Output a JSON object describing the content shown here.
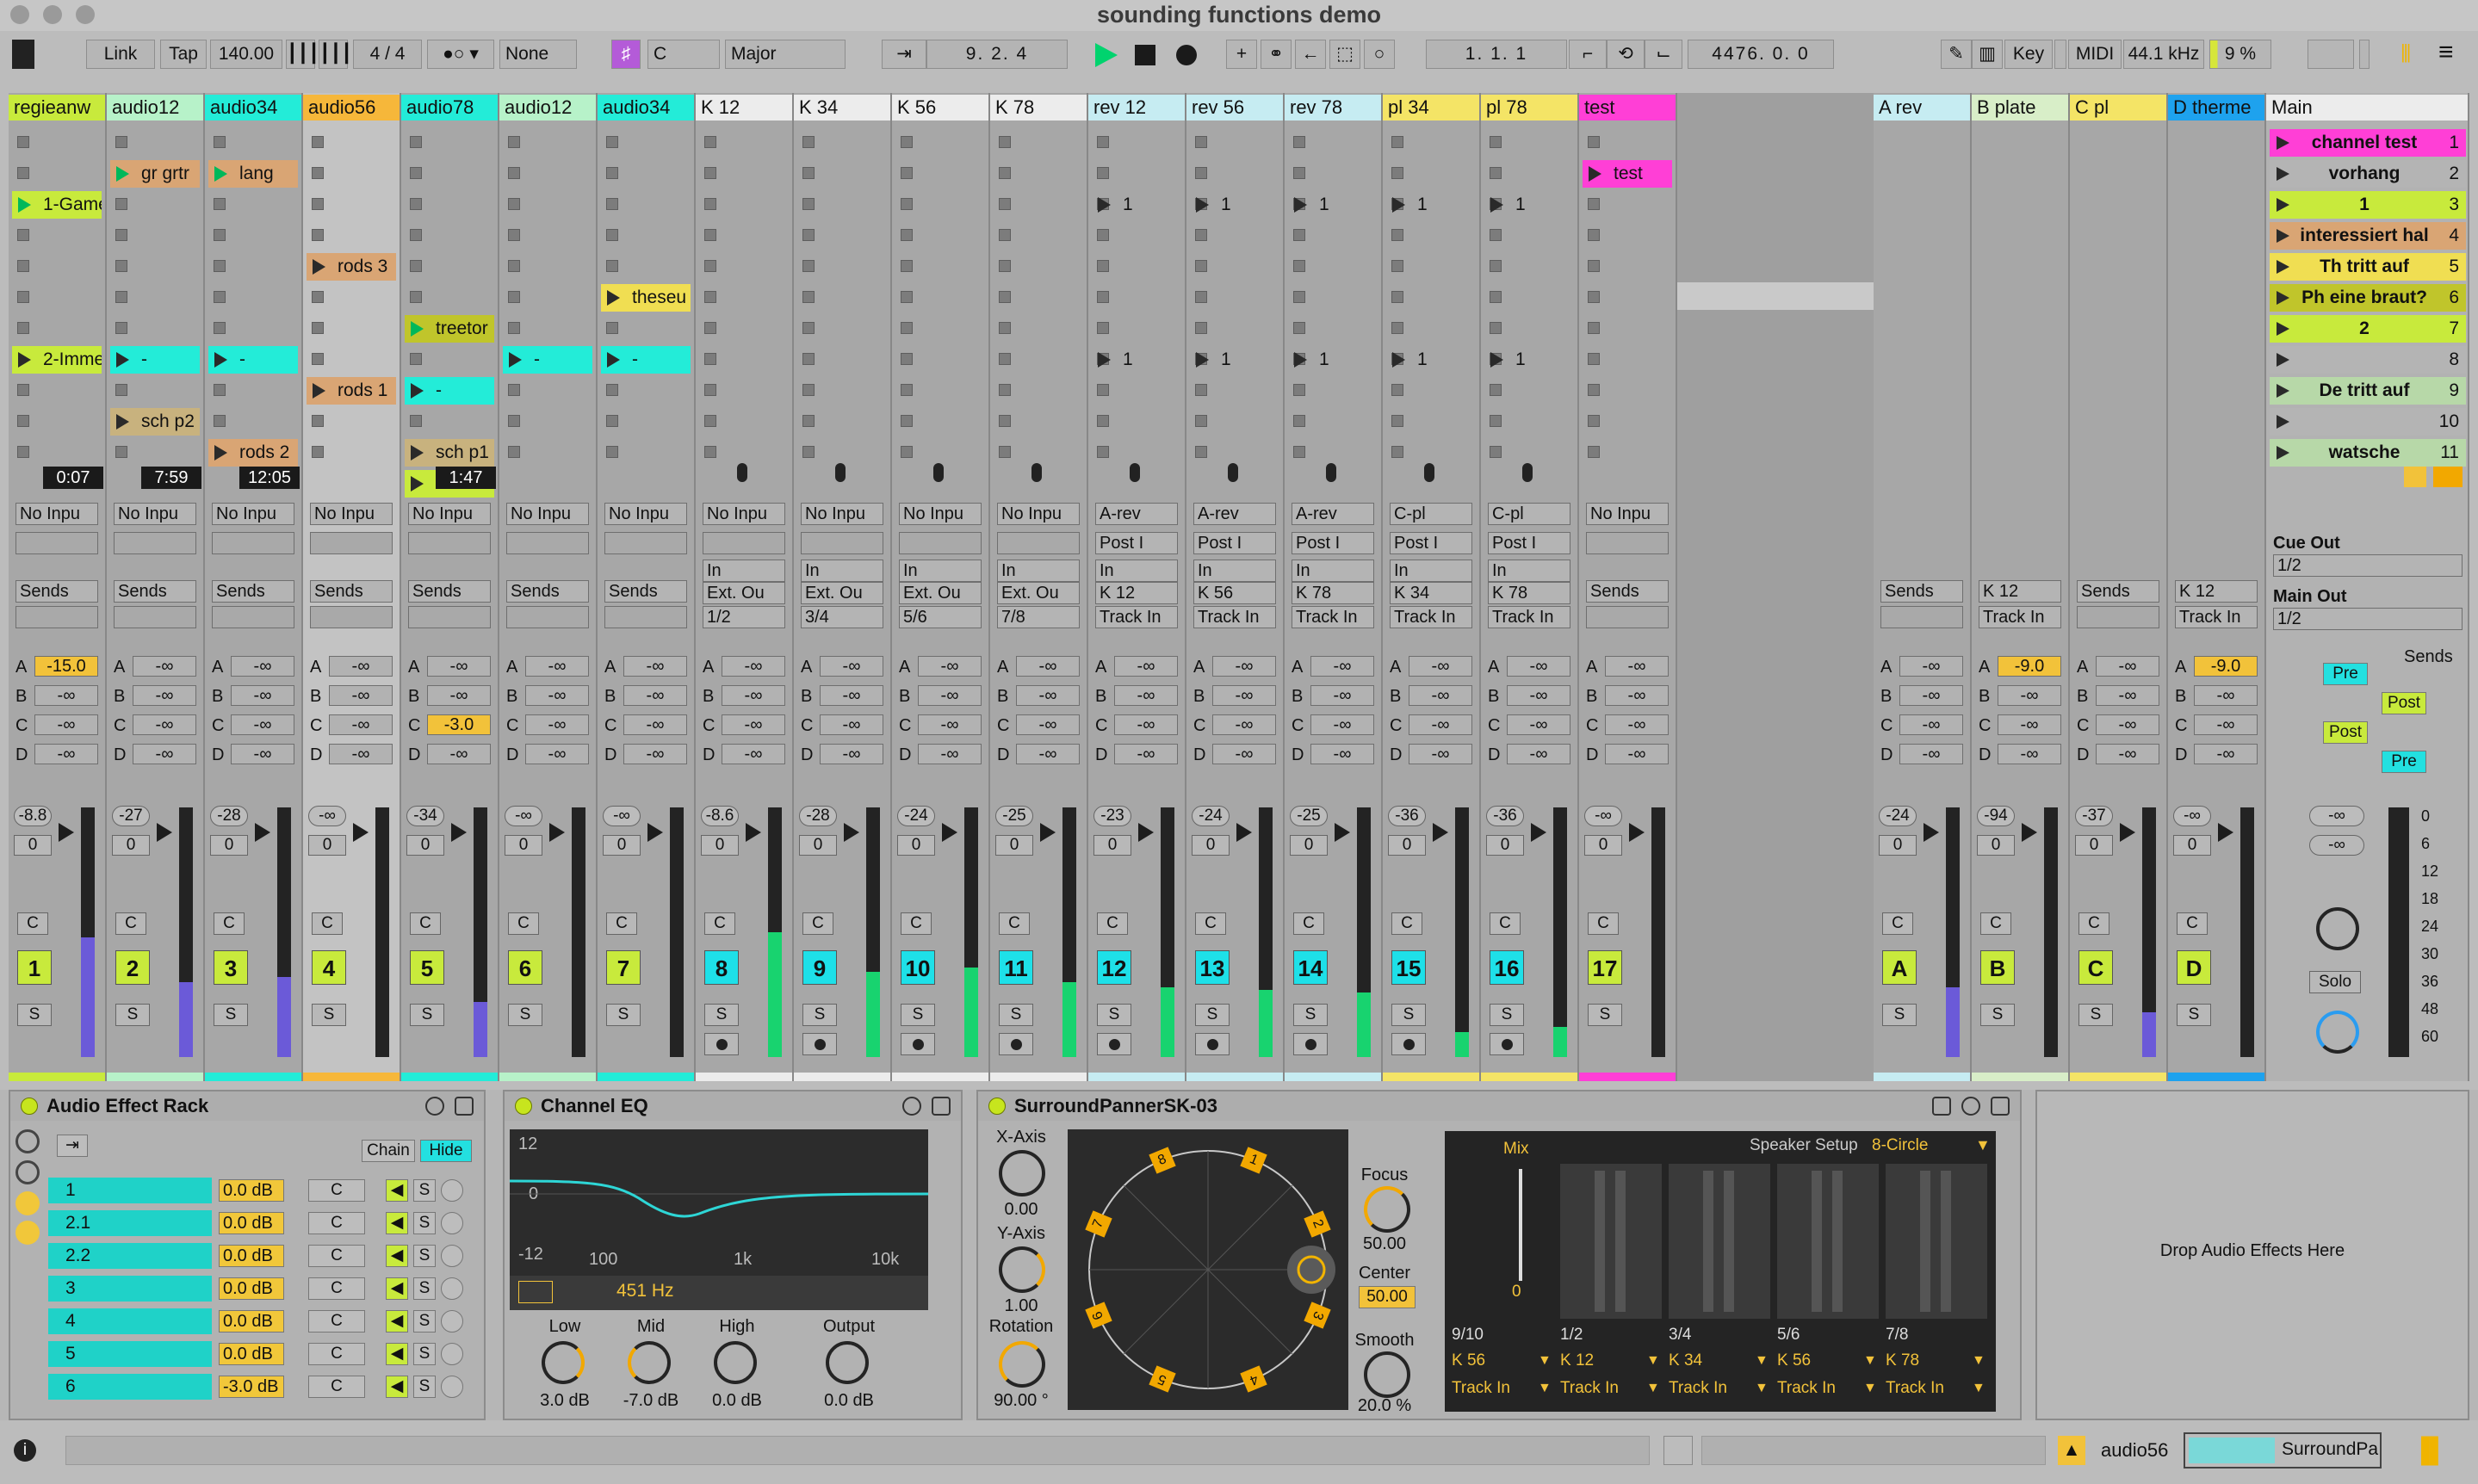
{
  "window": {
    "title": "sounding functions demo"
  },
  "toolbar": {
    "link": "Link",
    "tap": "Tap",
    "tempo": "140.00",
    "signature": "4 / 4",
    "quantize": "None",
    "key": "C",
    "scale": "Major",
    "loop_position": "9.  2.  4",
    "arrangement_position": "1.  1.  1",
    "loop_length": "4476.  0.  0",
    "key_label": "Key",
    "midi_label": "MIDI",
    "sample_rate": "44.1 kHz",
    "cpu": "9 %"
  },
  "tracks": [
    {
      "name": "regieanw",
      "color": "#c8ea3c",
      "label_color": "#c8ea3c",
      "num": "1",
      "vol": "-8.8",
      "pan": "0",
      "clips": [
        {
          "row": 2,
          "text": "1-Game",
          "color": "#c8ea3c",
          "playing": true
        },
        {
          "row": 7,
          "text": "2-Imme",
          "color": "#c8ea3c"
        }
      ],
      "time": "0:07",
      "input": "No Inpu",
      "sends_label": "Sends",
      "sends": [
        "-15.0",
        "-∞",
        "-∞",
        "-∞"
      ],
      "hot": [
        0
      ],
      "meter": 0.48,
      "meter_color": "#6b5ad8",
      "numcolor": "#c8ea3c",
      "arm": false
    },
    {
      "name": "audio12",
      "color": "#b7f2c9",
      "num": "2",
      "vol": "-27",
      "pan": "0",
      "clips": [
        {
          "row": 1,
          "text": "gr grtr",
          "color": "#d9a574",
          "playing": true
        },
        {
          "row": 7,
          "text": "-",
          "color": "#23ecd8"
        },
        {
          "row": 9,
          "text": "sch p2",
          "color": "#c8b27e"
        }
      ],
      "time": "7:59",
      "input": "No Inpu",
      "sends_label": "Sends",
      "sends": [
        "-∞",
        "-∞",
        "-∞",
        "-∞"
      ],
      "hot": [],
      "meter": 0.3,
      "meter_color": "#6b5ad8",
      "numcolor": "#c8ea3c",
      "arm": false
    },
    {
      "name": "audio34",
      "color": "#23ecd8",
      "num": "3",
      "vol": "-28",
      "pan": "0",
      "clips": [
        {
          "row": 1,
          "text": "lang",
          "color": "#d9a574",
          "playing": true
        },
        {
          "row": 7,
          "text": "-",
          "color": "#23ecd8"
        },
        {
          "row": 10,
          "text": "rods 2",
          "color": "#d9a574"
        }
      ],
      "time": "12:05",
      "input": "No Inpu",
      "sends_label": "Sends",
      "sends": [
        "-∞",
        "-∞",
        "-∞",
        "-∞"
      ],
      "hot": [],
      "meter": 0.32,
      "meter_color": "#6b5ad8",
      "numcolor": "#c8ea3c",
      "arm": false
    },
    {
      "name": "audio56",
      "color": "#f6b73a",
      "num": "4",
      "vol": "-∞",
      "pan": "0",
      "clips": [
        {
          "row": 4,
          "text": "rods 3",
          "color": "#d9a574"
        },
        {
          "row": 8,
          "text": "rods 1",
          "color": "#d9a574"
        }
      ],
      "time": "",
      "input": "No Inpu",
      "sends_label": "Sends",
      "sends": [
        "-∞",
        "-∞",
        "-∞",
        "-∞"
      ],
      "hot": [],
      "meter": 0.0,
      "meter_color": "#6b5ad8",
      "numcolor": "#c8ea3c",
      "arm": false,
      "selected": true
    },
    {
      "name": "audio78",
      "color": "#23ecd8",
      "num": "5",
      "vol": "-34",
      "pan": "0",
      "clips": [
        {
          "row": 6,
          "text": "treetor",
          "color": "#c0c52b",
          "playing": true
        },
        {
          "row": 8,
          "text": "-",
          "color": "#23ecd8"
        },
        {
          "row": 10,
          "text": "sch p1",
          "color": "#c8b27e"
        },
        {
          "row": 11,
          "text": "-",
          "color": "#c8ea3c"
        }
      ],
      "time": "1:47",
      "input": "No Inpu",
      "sends_label": "Sends",
      "sends": [
        "-∞",
        "-∞",
        "-3.0",
        "-∞"
      ],
      "hot": [
        2
      ],
      "meter": 0.22,
      "meter_color": "#6b5ad8",
      "numcolor": "#c8ea3c",
      "arm": false
    },
    {
      "name": "audio12",
      "color": "#b7f2c9",
      "num": "6",
      "vol": "-∞",
      "pan": "0",
      "clips": [
        {
          "row": 7,
          "text": "-",
          "color": "#23ecd8"
        }
      ],
      "time": "",
      "input": "No Inpu",
      "sends_label": "Sends",
      "sends": [
        "-∞",
        "-∞",
        "-∞",
        "-∞"
      ],
      "hot": [],
      "meter": 0.0,
      "meter_color": "#6b5ad8",
      "numcolor": "#c8ea3c",
      "arm": false
    },
    {
      "name": "audio34",
      "color": "#23ecd8",
      "num": "7",
      "vol": "-∞",
      "pan": "0",
      "clips": [
        {
          "row": 5,
          "text": "theseu",
          "color": "#f0de52"
        },
        {
          "row": 7,
          "text": "-",
          "color": "#23ecd8"
        }
      ],
      "time": "",
      "input": "No Inpu",
      "sends_label": "Sends",
      "sends": [
        "-∞",
        "-∞",
        "-∞",
        "-∞"
      ],
      "hot": [],
      "meter": 0.0,
      "meter_color": "#6b5ad8",
      "numcolor": "#c8ea3c",
      "arm": false
    },
    {
      "name": "K 12",
      "color": "#ececec",
      "num": "8",
      "vol": "-8.6",
      "pan": "0",
      "clips": [],
      "input": "No Inpu",
      "in": "In",
      "out": "Ext. Ou",
      "route": "1/2",
      "sends": [
        "-∞",
        "-∞",
        "-∞",
        "-∞"
      ],
      "hot": [],
      "meter": 0.5,
      "meter_color": "#18d36f",
      "numcolor": "#1ee0e8",
      "arm": true
    },
    {
      "name": "K 34",
      "color": "#ececec",
      "num": "9",
      "vol": "-28",
      "pan": "0",
      "clips": [],
      "input": "No Inpu",
      "in": "In",
      "out": "Ext. Ou",
      "route": "3/4",
      "sends": [
        "-∞",
        "-∞",
        "-∞",
        "-∞"
      ],
      "hot": [],
      "meter": 0.34,
      "meter_color": "#18d36f",
      "numcolor": "#1ee0e8",
      "arm": true
    },
    {
      "name": "K 56",
      "color": "#ececec",
      "num": "10",
      "vol": "-24",
      "pan": "0",
      "clips": [],
      "input": "No Inpu",
      "in": "In",
      "out": "Ext. Ou",
      "route": "5/6",
      "sends": [
        "-∞",
        "-∞",
        "-∞",
        "-∞"
      ],
      "hot": [],
      "meter": 0.36,
      "meter_color": "#18d36f",
      "numcolor": "#1ee0e8",
      "arm": true
    },
    {
      "name": "K 78",
      "color": "#ececec",
      "num": "11",
      "vol": "-25",
      "pan": "0",
      "clips": [],
      "input": "No Inpu",
      "in": "In",
      "out": "Ext. Ou",
      "route": "7/8",
      "sends": [
        "-∞",
        "-∞",
        "-∞",
        "-∞"
      ],
      "hot": [],
      "meter": 0.3,
      "meter_color": "#18d36f",
      "numcolor": "#1ee0e8",
      "arm": true
    },
    {
      "name": "rev 12",
      "color": "#c6ecf2",
      "num": "12",
      "vol": "-23",
      "pan": "0",
      "clips": [
        {
          "row": 2,
          "text": "1",
          "color": "none"
        },
        {
          "row": 7,
          "text": "1",
          "color": "none"
        }
      ],
      "input": "A-rev",
      "post": "Post I",
      "in": "In",
      "out": "K 12",
      "route_text": "Track In",
      "sends": [
        "-∞",
        "-∞",
        "-∞",
        "-∞"
      ],
      "hot": [],
      "meter": 0.28,
      "meter_color": "#18d36f",
      "numcolor": "#1ee0e8",
      "arm": true
    },
    {
      "name": "rev 56",
      "color": "#c6ecf2",
      "num": "13",
      "vol": "-24",
      "pan": "0",
      "clips": [
        {
          "row": 2,
          "text": "1",
          "color": "none"
        },
        {
          "row": 7,
          "text": "1",
          "color": "none"
        }
      ],
      "input": "A-rev",
      "post": "Post I",
      "in": "In",
      "out": "K 56",
      "route_text": "Track In",
      "sends": [
        "-∞",
        "-∞",
        "-∞",
        "-∞"
      ],
      "hot": [],
      "meter": 0.27,
      "meter_color": "#18d36f",
      "numcolor": "#1ee0e8",
      "arm": true
    },
    {
      "name": "rev 78",
      "color": "#c6ecf2",
      "num": "14",
      "vol": "-25",
      "pan": "0",
      "clips": [
        {
          "row": 2,
          "text": "1",
          "color": "none"
        },
        {
          "row": 7,
          "text": "1",
          "color": "none"
        }
      ],
      "input": "A-rev",
      "post": "Post I",
      "in": "In",
      "out": "K 78",
      "route_text": "Track In",
      "sends": [
        "-∞",
        "-∞",
        "-∞",
        "-∞"
      ],
      "hot": [],
      "meter": 0.26,
      "meter_color": "#18d36f",
      "numcolor": "#1ee0e8",
      "arm": true
    },
    {
      "name": "pl 34",
      "color": "#f4e466",
      "num": "15",
      "vol": "-36",
      "pan": "0",
      "clips": [
        {
          "row": 2,
          "text": "1",
          "color": "none"
        },
        {
          "row": 7,
          "text": "1",
          "color": "none"
        }
      ],
      "input": "C-pl",
      "post": "Post I",
      "in": "In",
      "out": "K 34",
      "route_text": "Track In",
      "sends": [
        "-∞",
        "-∞",
        "-∞",
        "-∞"
      ],
      "hot": [],
      "meter": 0.1,
      "meter_color": "#18d36f",
      "numcolor": "#1ee0e8",
      "arm": true
    },
    {
      "name": "pl 78",
      "color": "#f4e466",
      "num": "16",
      "vol": "-36",
      "pan": "0",
      "clips": [
        {
          "row": 2,
          "text": "1",
          "color": "none"
        },
        {
          "row": 7,
          "text": "1",
          "color": "none"
        }
      ],
      "input": "C-pl",
      "post": "Post I",
      "in": "In",
      "out": "K 78",
      "route_text": "Track In",
      "sends": [
        "-∞",
        "-∞",
        "-∞",
        "-∞"
      ],
      "hot": [],
      "meter": 0.12,
      "meter_color": "#18d36f",
      "numcolor": "#1ee0e8",
      "arm": true
    },
    {
      "name": "test",
      "color": "#ff3fd6",
      "num": "17",
      "vol": "-∞",
      "pan": "0",
      "clips": [
        {
          "row": 1,
          "text": "test",
          "color": "#ff3fd6"
        }
      ],
      "input": "No Inpu",
      "sends_label": "Sends",
      "sends": [
        "-∞",
        "-∞",
        "-∞",
        "-∞"
      ],
      "hot": [],
      "meter": 0.0,
      "meter_color": "#18d36f",
      "numcolor": "#c8ea3c",
      "arm": false
    }
  ],
  "returns": [
    {
      "name": "A rev",
      "color": "#c6ecf2",
      "num": "A",
      "vol": "-24",
      "pan": "0",
      "out_label": "Sends",
      "sends": [
        "-∞",
        "-∞",
        "-∞",
        "-∞"
      ],
      "hot": [],
      "meter": 0.28,
      "meter_color": "#6b5ad8"
    },
    {
      "name": "B plate",
      "color": "#d8eec8",
      "num": "B",
      "vol": "-94",
      "pan": "0",
      "out_label": "K 12",
      "route_text": "Track In",
      "sends": [
        "-9.0",
        "-∞",
        "-∞",
        "-∞"
      ],
      "hot": [
        0
      ],
      "meter": 0.0,
      "meter_color": "#6b5ad8"
    },
    {
      "name": "C pl",
      "color": "#f4e466",
      "num": "C",
      "vol": "-37",
      "pan": "0",
      "out_label": "Sends",
      "sends": [
        "-∞",
        "-∞",
        "-∞",
        "-∞"
      ],
      "hot": [],
      "meter": 0.18,
      "meter_color": "#6b5ad8"
    },
    {
      "name": "D therme",
      "color": "#1ea2ee",
      "num": "D",
      "vol": "-∞",
      "pan": "0",
      "out_label": "K 12",
      "route_text": "Track In",
      "sends": [
        "-9.0",
        "-∞",
        "-∞",
        "-∞"
      ],
      "hot": [
        0
      ],
      "meter": 0.0,
      "meter_color": "#6b5ad8"
    }
  ],
  "main": {
    "name": "Main",
    "scenes": [
      {
        "name": "channel test",
        "num": "1",
        "color": "#ff3fd6"
      },
      {
        "name": "vorhang",
        "num": "2",
        "color": "#b4b4b4"
      },
      {
        "name": "1",
        "num": "3",
        "color": "#c8ea3c"
      },
      {
        "name": "interessiert hal",
        "num": "4",
        "color": "#d9a574"
      },
      {
        "name": "Th tritt auf",
        "num": "5",
        "color": "#f0de52"
      },
      {
        "name": "Ph eine braut?",
        "num": "6",
        "color": "#c0c52b"
      },
      {
        "name": "2",
        "num": "7",
        "color": "#c8ea3c"
      },
      {
        "name": "",
        "num": "8",
        "color": "#b4b4b4"
      },
      {
        "name": "De tritt auf",
        "num": "9",
        "color": "#b7d8a8"
      },
      {
        "name": "",
        "num": "10",
        "color": "#b4b4b4"
      },
      {
        "name": "watsche",
        "num": "11",
        "color": "#b7d8a8"
      }
    ],
    "cue_out_label": "Cue Out",
    "cue_out": "1/2",
    "main_out_label": "Main Out",
    "main_out": "1/2",
    "sends_label": "Sends",
    "prepost": [
      "Pre",
      "Post",
      "Post",
      "Pre"
    ],
    "vol_top": "-∞",
    "vol_bottom": "-∞",
    "scale": [
      "0",
      "6",
      "12",
      "18",
      "24",
      "30",
      "36",
      "48",
      "60"
    ],
    "solo": "Solo"
  },
  "devices": {
    "rack": {
      "title": "Audio Effect Rack",
      "chain_btn": "Chain",
      "hide_btn": "Hide",
      "chains": [
        {
          "name": "1",
          "db": "0.0 dB"
        },
        {
          "name": "2.1",
          "db": "0.0 dB"
        },
        {
          "name": "2.2",
          "db": "0.0 dB"
        },
        {
          "name": "3",
          "db": "0.0 dB"
        },
        {
          "name": "4",
          "db": "0.0 dB"
        },
        {
          "name": "5",
          "db": "0.0 dB"
        },
        {
          "name": "6",
          "db": "-3.0 dB"
        }
      ],
      "c_label": "C",
      "s_label": "S"
    },
    "eq": {
      "title": "Channel EQ",
      "y_top": "12",
      "y_mid": "0",
      "y_bottom": "-12",
      "x_labels": [
        "100",
        "1k",
        "10k"
      ],
      "freq": "451 Hz",
      "knobs": [
        {
          "label": "Low",
          "value": "3.0 dB"
        },
        {
          "label": "Mid",
          "value": "-7.0 dB"
        },
        {
          "label": "High",
          "value": "0.0 dB"
        },
        {
          "label": "Output",
          "value": "0.0 dB"
        }
      ]
    },
    "panner": {
      "title": "SurroundPannerSK-03",
      "x_axis_label": "X-Axis",
      "x_axis": "0.00",
      "y_axis_label": "Y-Axis",
      "y_axis": "1.00",
      "rotation_label": "Rotation",
      "rotation": "90.00 °",
      "focus_label": "Focus",
      "focus": "50.00",
      "center_label": "Center",
      "center": "50.00",
      "smooth_label": "Smooth",
      "smooth": "20.0 %",
      "mix_label": "Mix",
      "mix": "0",
      "speaker_setup_label": "Speaker Setup",
      "speaker_setup": "8-Circle",
      "speakers": [
        "1",
        "2",
        "3",
        "4",
        "5",
        "6",
        "7",
        "8"
      ],
      "outs": [
        {
          "pair": "9/10",
          "target": "K 56",
          "mode": "Track In"
        },
        {
          "pair": "1/2",
          "target": "K 12",
          "mode": "Track In"
        },
        {
          "pair": "3/4",
          "target": "K 34",
          "mode": "Track In"
        },
        {
          "pair": "5/6",
          "target": "K 56",
          "mode": "Track In"
        },
        {
          "pair": "7/8",
          "target": "K 78",
          "mode": "Track In"
        }
      ]
    },
    "drop_text": "Drop Audio Effects Here"
  },
  "statusbar": {
    "track": "audio56",
    "device": "SurroundPa"
  }
}
